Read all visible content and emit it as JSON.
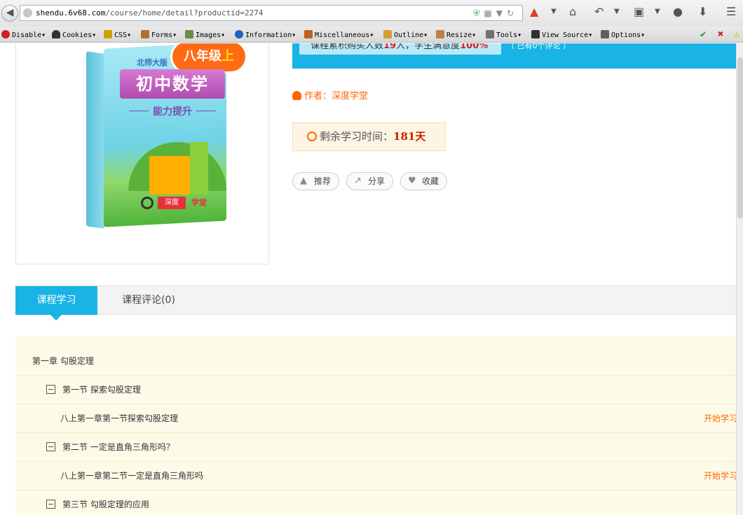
{
  "browser": {
    "url_host": "shendu.6v68.com",
    "url_path": "/course/home/detail?productid=2274"
  },
  "devbar": {
    "items": [
      "Disable",
      "Cookies",
      "CSS",
      "Forms",
      "Images",
      "Information",
      "Miscellaneous",
      "Outline",
      "Resize",
      "Tools",
      "View Source",
      "Options"
    ]
  },
  "book": {
    "grade": "八年级",
    "grade_suffix": "上",
    "publisher": "北师大版",
    "title": "初中数学",
    "subtitle": "能力提升",
    "logo": "深度",
    "logo2": "学堂"
  },
  "info": {
    "stat_prefix": "课程累积购买人数",
    "buyers": "19",
    "stat_mid": "人，学生满意度",
    "satisfaction": "100%",
    "comments": "（ 已有0个评论 ）"
  },
  "author": {
    "label": "作者：深度学堂"
  },
  "remain": {
    "label": "剩余学习时间：",
    "days": "181天"
  },
  "buttons": {
    "recommend": "推荐",
    "share": "分享",
    "favorite": "收藏"
  },
  "tabs": {
    "study": "课程学习",
    "reviews": "课程评论(0)"
  },
  "chapter": {
    "title": "第一章 勾股定理",
    "start": "开始学习",
    "sections": [
      {
        "title": "第一节 探索勾股定理",
        "lesson": "八上第一章第一节探索勾股定理"
      },
      {
        "title": "第二节 一定是直角三角形吗？",
        "lesson": "八上第一章第二节一定是直角三角形吗"
      },
      {
        "title": "第三节 勾股定理的应用"
      }
    ]
  }
}
